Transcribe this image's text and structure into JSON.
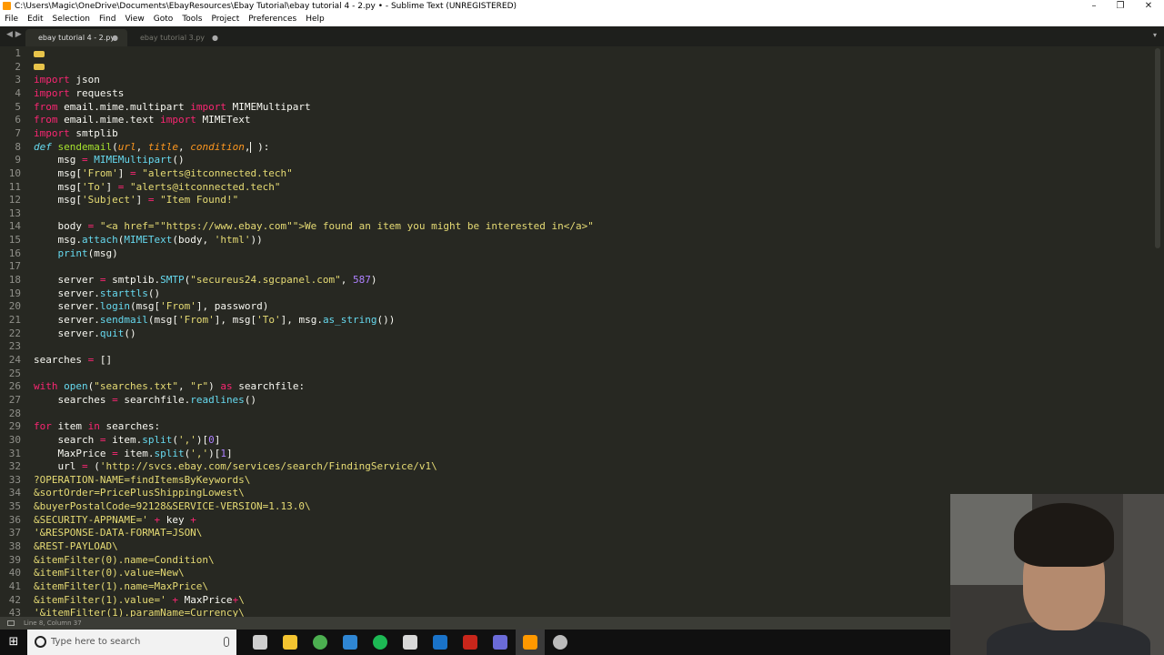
{
  "window": {
    "title": "C:\\Users\\Magic\\OneDrive\\Documents\\EbayResources\\Ebay Tutorial\\ebay tutorial 4 - 2.py • - Sublime Text (UNREGISTERED)",
    "controls": [
      "–",
      "❐",
      "✕"
    ]
  },
  "menu": [
    "File",
    "Edit",
    "Selection",
    "Find",
    "View",
    "Goto",
    "Tools",
    "Project",
    "Preferences",
    "Help"
  ],
  "tabs": [
    {
      "label": "ebay tutorial 4 - 2.py",
      "close": "●",
      "active": true
    },
    {
      "label": "ebay tutorial 3.py",
      "close": "●",
      "active": false
    }
  ],
  "tab_nav": "◀ ▶",
  "tab_dropdown": "▾",
  "editor": {
    "line_numbers": [
      "1",
      "2",
      "3",
      "4",
      "5",
      "6",
      "7",
      "8",
      "9",
      "10",
      "11",
      "12",
      "13",
      "14",
      "15",
      "16",
      "17",
      "18",
      "19",
      "20",
      "21",
      "22",
      "23",
      "24",
      "25",
      "26",
      "27",
      "28",
      "29",
      "30",
      "31",
      "32",
      "33",
      "34",
      "35",
      "36",
      "37",
      "38",
      "39",
      "40",
      "41",
      "42",
      "43"
    ],
    "lines": [
      {
        "t": [
          [
            "fold",
            ""
          ]
        ]
      },
      {
        "t": [
          [
            "fold",
            ""
          ]
        ]
      },
      {
        "t": [
          [
            "kw",
            "import"
          ],
          [
            "",
            " json"
          ]
        ]
      },
      {
        "t": [
          [
            "kw",
            "import"
          ],
          [
            "",
            " requests"
          ]
        ]
      },
      {
        "t": [
          [
            "kw",
            "from"
          ],
          [
            "",
            " email.mime.multipart "
          ],
          [
            "kw",
            "import"
          ],
          [
            "",
            " MIMEMultipart"
          ]
        ]
      },
      {
        "t": [
          [
            "kw",
            "from"
          ],
          [
            "",
            " email.mime.text "
          ],
          [
            "kw",
            "import"
          ],
          [
            "",
            " MIMEText"
          ]
        ]
      },
      {
        "t": [
          [
            "kw",
            "import"
          ],
          [
            "",
            " smtplib"
          ]
        ]
      },
      {
        "t": [
          [
            "it",
            "def"
          ],
          [
            "",
            " "
          ],
          [
            "df",
            "sendemail"
          ],
          [
            "",
            "("
          ],
          [
            "pa",
            "url"
          ],
          [
            "",
            ", "
          ],
          [
            "pa",
            "title"
          ],
          [
            "",
            ", "
          ],
          [
            "pa",
            "condition"
          ],
          [
            "",
            ","
          ],
          [
            "caret",
            ""
          ],
          [
            "",
            " ):"
          ]
        ]
      },
      {
        "t": [
          [
            "",
            "    msg "
          ],
          [
            "kw",
            "="
          ],
          [
            "",
            " "
          ],
          [
            "fn",
            "MIMEMultipart"
          ],
          [
            "",
            "()"
          ]
        ]
      },
      {
        "t": [
          [
            "",
            "    msg["
          ],
          [
            "st",
            "'From'"
          ],
          [
            "",
            "] "
          ],
          [
            "kw",
            "="
          ],
          [
            "",
            " "
          ],
          [
            "st",
            "\"alerts@itconnected.tech\""
          ]
        ]
      },
      {
        "t": [
          [
            "",
            "    msg["
          ],
          [
            "st",
            "'To'"
          ],
          [
            "",
            "] "
          ],
          [
            "kw",
            "="
          ],
          [
            "",
            " "
          ],
          [
            "st",
            "\"alerts@itconnected.tech\""
          ]
        ]
      },
      {
        "t": [
          [
            "",
            "    msg["
          ],
          [
            "st",
            "'Subject'"
          ],
          [
            "",
            "] "
          ],
          [
            "kw",
            "="
          ],
          [
            "",
            " "
          ],
          [
            "st",
            "\"Item Found!\""
          ]
        ]
      },
      {
        "t": [
          [
            "",
            ""
          ]
        ]
      },
      {
        "t": [
          [
            "",
            "    body "
          ],
          [
            "kw",
            "="
          ],
          [
            "",
            " "
          ],
          [
            "st",
            "\"<a href=\"\"https://www.ebay.com\"\">We found an item you might be interested in</a>\""
          ]
        ]
      },
      {
        "t": [
          [
            "",
            "    msg."
          ],
          [
            "fn",
            "attach"
          ],
          [
            "",
            "("
          ],
          [
            "fn",
            "MIMEText"
          ],
          [
            "",
            "(body, "
          ],
          [
            "st",
            "'html'"
          ],
          [
            "",
            "))"
          ]
        ]
      },
      {
        "t": [
          [
            "",
            "    "
          ],
          [
            "fn",
            "print"
          ],
          [
            "",
            "(msg)"
          ]
        ]
      },
      {
        "t": [
          [
            "",
            ""
          ]
        ]
      },
      {
        "t": [
          [
            "",
            "    server "
          ],
          [
            "kw",
            "="
          ],
          [
            "",
            " smtplib."
          ],
          [
            "fn",
            "SMTP"
          ],
          [
            "",
            "("
          ],
          [
            "st",
            "\"secureus24.sgcpanel.com\""
          ],
          [
            "",
            ", "
          ],
          [
            "nu",
            "587"
          ],
          [
            "",
            ")"
          ]
        ]
      },
      {
        "t": [
          [
            "",
            "    server."
          ],
          [
            "fn",
            "starttls"
          ],
          [
            "",
            "()"
          ]
        ]
      },
      {
        "t": [
          [
            "",
            "    server."
          ],
          [
            "fn",
            "login"
          ],
          [
            "",
            "(msg["
          ],
          [
            "st",
            "'From'"
          ],
          [
            "",
            "], password)"
          ]
        ]
      },
      {
        "t": [
          [
            "",
            "    server."
          ],
          [
            "fn",
            "sendmail"
          ],
          [
            "",
            "(msg["
          ],
          [
            "st",
            "'From'"
          ],
          [
            "",
            "], msg["
          ],
          [
            "st",
            "'To'"
          ],
          [
            "",
            "], msg."
          ],
          [
            "fn",
            "as_string"
          ],
          [
            "",
            "())"
          ]
        ]
      },
      {
        "t": [
          [
            "",
            "    server."
          ],
          [
            "fn",
            "quit"
          ],
          [
            "",
            "()"
          ]
        ]
      },
      {
        "t": [
          [
            "",
            ""
          ]
        ]
      },
      {
        "t": [
          [
            "",
            "searches "
          ],
          [
            "kw",
            "="
          ],
          [
            "",
            " []"
          ]
        ]
      },
      {
        "t": [
          [
            "",
            ""
          ]
        ]
      },
      {
        "t": [
          [
            "kw",
            "with"
          ],
          [
            "",
            " "
          ],
          [
            "fn",
            "open"
          ],
          [
            "",
            "("
          ],
          [
            "st",
            "\"searches.txt\""
          ],
          [
            "",
            ", "
          ],
          [
            "st",
            "\"r\""
          ],
          [
            "",
            ") "
          ],
          [
            "kw",
            "as"
          ],
          [
            "",
            " searchfile:"
          ]
        ]
      },
      {
        "t": [
          [
            "",
            "    searches "
          ],
          [
            "kw",
            "="
          ],
          [
            "",
            " searchfile."
          ],
          [
            "fn",
            "readlines"
          ],
          [
            "",
            "()"
          ]
        ]
      },
      {
        "t": [
          [
            "",
            ""
          ]
        ]
      },
      {
        "t": [
          [
            "kw",
            "for"
          ],
          [
            "",
            " item "
          ],
          [
            "kw",
            "in"
          ],
          [
            "",
            " searches:"
          ]
        ]
      },
      {
        "t": [
          [
            "",
            "    search "
          ],
          [
            "kw",
            "="
          ],
          [
            "",
            " item."
          ],
          [
            "fn",
            "split"
          ],
          [
            "",
            "("
          ],
          [
            "st",
            "','"
          ],
          [
            "",
            ")["
          ],
          [
            "nu",
            "0"
          ],
          [
            "",
            "]"
          ]
        ]
      },
      {
        "t": [
          [
            "",
            "    MaxPrice "
          ],
          [
            "kw",
            "="
          ],
          [
            "",
            " item."
          ],
          [
            "fn",
            "split"
          ],
          [
            "",
            "("
          ],
          [
            "st",
            "','"
          ],
          [
            "",
            ")["
          ],
          [
            "nu",
            "1"
          ],
          [
            "",
            "]"
          ]
        ]
      },
      {
        "t": [
          [
            "",
            "    url "
          ],
          [
            "kw",
            "="
          ],
          [
            "",
            " ("
          ],
          [
            "st",
            "'http://svcs.ebay.com/services/search/FindingService/v1\\"
          ]
        ]
      },
      {
        "t": [
          [
            "st",
            "?OPERATION-NAME=findItemsByKeywords\\"
          ]
        ]
      },
      {
        "t": [
          [
            "st",
            "&sortOrder=PricePlusShippingLowest\\"
          ]
        ]
      },
      {
        "t": [
          [
            "st",
            "&buyerPostalCode=92128&SERVICE-VERSION=1.13.0\\"
          ]
        ]
      },
      {
        "t": [
          [
            "st",
            "&SECURITY-APPNAME='"
          ],
          [
            "",
            " "
          ],
          [
            "kw",
            "+"
          ],
          [
            "",
            " key "
          ],
          [
            "kw",
            "+"
          ]
        ]
      },
      {
        "t": [
          [
            "st",
            "'&RESPONSE-DATA-FORMAT=JSON\\"
          ]
        ]
      },
      {
        "t": [
          [
            "st",
            "&REST-PAYLOAD\\"
          ]
        ]
      },
      {
        "t": [
          [
            "st",
            "&itemFilter(0).name=Condition\\"
          ]
        ]
      },
      {
        "t": [
          [
            "st",
            "&itemFilter(0).value=New\\"
          ]
        ]
      },
      {
        "t": [
          [
            "st",
            "&itemFilter(1).name=MaxPrice\\"
          ]
        ]
      },
      {
        "t": [
          [
            "st",
            "&itemFilter(1).value='"
          ],
          [
            "",
            " "
          ],
          [
            "kw",
            "+"
          ],
          [
            "",
            " MaxPrice"
          ],
          [
            "kw",
            "+"
          ],
          [
            "st",
            "\\"
          ]
        ]
      },
      {
        "t": [
          [
            "st",
            "'&itemFilter(1).paramName=Currency\\"
          ]
        ]
      }
    ]
  },
  "status": {
    "text": "Line 8, Column 37"
  },
  "taskbar": {
    "start_icon": "⊞",
    "search_placeholder": "Type here to search",
    "apps": [
      {
        "name": "task-view-icon",
        "color": "#cfcfcf"
      },
      {
        "name": "file-explorer-icon",
        "color": "#f4c430"
      },
      {
        "name": "chrome-icon",
        "color": "#4caf50"
      },
      {
        "name": "vscode-icon",
        "color": "#2f86d3"
      },
      {
        "name": "spotify-icon",
        "color": "#1db954"
      },
      {
        "name": "notepad-icon",
        "color": "#d8d8d8"
      },
      {
        "name": "edge-icon",
        "color": "#1a73c9"
      },
      {
        "name": "filezilla-icon",
        "color": "#c8261b"
      },
      {
        "name": "remote-desktop-icon",
        "color": "#6b6bd8"
      },
      {
        "name": "sublime-text-icon",
        "color": "#ff9800",
        "active": true
      },
      {
        "name": "settings-icon",
        "color": "#bbbbbb"
      }
    ]
  }
}
